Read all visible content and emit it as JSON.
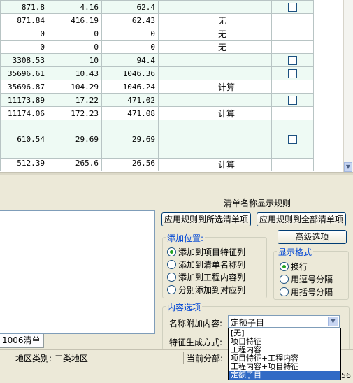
{
  "grid": {
    "rows": [
      {
        "a": "871.8",
        "b": "4.16",
        "c": "62.4",
        "note": "",
        "checkbox": true,
        "alt": true
      },
      {
        "a": "871.84",
        "b": "416.19",
        "c": "62.43",
        "note": "无",
        "checkbox": false,
        "alt": false
      },
      {
        "a": "0",
        "b": "0",
        "c": "0",
        "note": "无",
        "checkbox": false,
        "alt": false
      },
      {
        "a": "0",
        "b": "0",
        "c": "0",
        "note": "无",
        "checkbox": false,
        "alt": false
      },
      {
        "a": "3308.53",
        "b": "10",
        "c": "94.4",
        "note": "",
        "checkbox": true,
        "alt": true
      },
      {
        "a": "35696.61",
        "b": "10.43",
        "c": "1046.36",
        "note": "",
        "checkbox": true,
        "alt": true
      },
      {
        "a": "35696.87",
        "b": "104.29",
        "c": "1046.24",
        "note": "计算",
        "checkbox": false,
        "alt": false
      },
      {
        "a": "11173.89",
        "b": "17.22",
        "c": "471.02",
        "note": "",
        "checkbox": true,
        "alt": true
      },
      {
        "a": "11174.06",
        "b": "172.23",
        "c": "471.08",
        "note": "计算",
        "checkbox": false,
        "alt": false
      },
      {
        "a": "610.54",
        "b": "29.69",
        "c": "29.69",
        "note": "",
        "checkbox": true,
        "alt": true,
        "tall": true
      },
      {
        "a": "512.39",
        "b": "265.6",
        "c": "26.56",
        "note": "计算",
        "checkbox": false,
        "alt": false,
        "cut": true
      }
    ]
  },
  "rules": {
    "title": "清单名称显示规则",
    "apply_selected_label": "应用规则到所选清单项",
    "apply_all_label": "应用规则到全部清单项",
    "advanced_label": "高级选项"
  },
  "add_position": {
    "title": "添加位置:",
    "options": [
      "添加到项目特征列",
      "添加到清单名称列",
      "添加到工程内容列",
      "分别添加到对应列"
    ],
    "selected_index": 0
  },
  "display_format": {
    "title": "显示格式",
    "options": [
      "换行",
      "用逗号分隔",
      "用括号分隔"
    ],
    "selected_index": 0
  },
  "content_options": {
    "title": "内容选项",
    "append_label": "名称附加内容:",
    "append_value": "定额子目",
    "generation_label": "特征生成方式:",
    "dropdown_items": [
      "[无]",
      "项目特征",
      "工程内容",
      "项目特征+工程内容",
      "工程内容+项目特征",
      "定额子目"
    ],
    "dropdown_selected_index": 5
  },
  "tab_label": "1006清单",
  "status": {
    "region": "地区类别: 二类地区",
    "current_section": "当前分部:",
    "corner": "56"
  }
}
